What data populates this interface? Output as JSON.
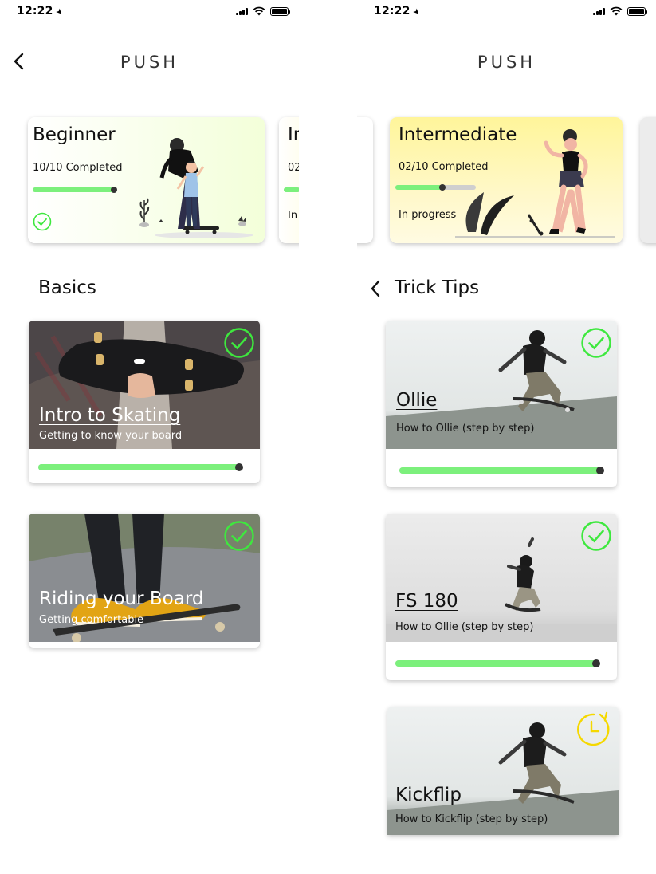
{
  "status_bar": {
    "time": "12:22"
  },
  "left_screen": {
    "nav_title": "PUSH",
    "levels": [
      {
        "title": "Beginner",
        "completed": "10/10 Completed",
        "progress": 1.0
      },
      {
        "title": "Intermediate",
        "completed": "02/10 Completed",
        "status": "In progress"
      }
    ],
    "section_title": "Basics",
    "lessons": [
      {
        "title": "Intro to Skating",
        "subtitle": "Getting to know your board",
        "progress": 1.0
      },
      {
        "title": "Riding your Board",
        "subtitle": "Getting comfortable"
      }
    ]
  },
  "right_screen": {
    "nav_title": "PUSH",
    "level": {
      "title": "Intermediate",
      "completed": "02/10 Completed",
      "status": "In progress",
      "progress": 0.2
    },
    "section_title": "Trick Tips",
    "lessons": [
      {
        "title": "Ollie",
        "subtitle": "How to Ollie (step by step)",
        "progress": 1.0,
        "state": "completed"
      },
      {
        "title": "FS 180",
        "subtitle": "How to Ollie (step by step)",
        "progress": 1.0,
        "state": "completed"
      },
      {
        "title": "Kickflip",
        "subtitle": "How to Kickflip (step by step)",
        "state": "in-progress"
      }
    ]
  },
  "colors": {
    "progress_green": "#7cf07c",
    "check_green": "#3ee83e",
    "pending_yellow": "#f5d800",
    "beginner_card_gradient": "#f3ffd9",
    "intermediate_card_gradient": "#fff6a0"
  },
  "icons": {
    "back": "chevron-left-icon",
    "completed": "check-circle-icon",
    "pending": "clock-icon"
  }
}
